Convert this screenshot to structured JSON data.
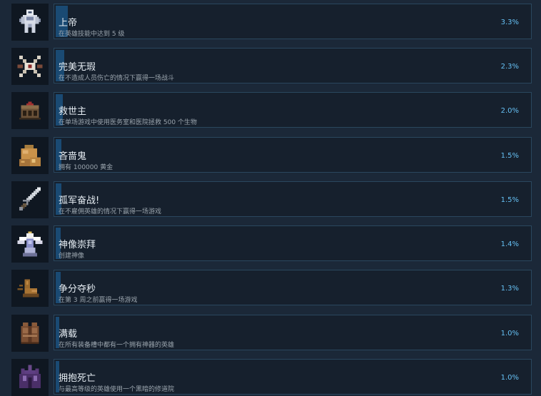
{
  "achievements": [
    {
      "title": "上帝",
      "description": "在英雄技能中达到 5 级",
      "percent_label": "3.3%",
      "percent_value": 3.3,
      "icon": "armored-god-icon"
    },
    {
      "title": "完美无瑕",
      "description": "在不造成人员伤亡的情况下赢得一场战斗",
      "percent_label": "2.3%",
      "percent_value": 2.3,
      "icon": "crossed-bones-eye-icon"
    },
    {
      "title": "救世主",
      "description": "在单场游戏中使用医务室和医院拯救 500 个生物",
      "percent_label": "2.0%",
      "percent_value": 2.0,
      "icon": "hospital-chest-icon"
    },
    {
      "title": "吝啬鬼",
      "description": "拥有 100000 黄金",
      "percent_label": "1.5%",
      "percent_value": 1.5,
      "icon": "gold-sacks-icon"
    },
    {
      "title": "孤军奋战!",
      "description": "在不雇佣英雄的情况下赢得一场游戏",
      "percent_label": "1.5%",
      "percent_value": 1.5,
      "icon": "sword-icon"
    },
    {
      "title": "神像崇拜",
      "description": "创建神像",
      "percent_label": "1.4%",
      "percent_value": 1.4,
      "icon": "winged-statue-icon"
    },
    {
      "title": "争分夺秒",
      "description": "在第 3 周之前赢得一场游戏",
      "percent_label": "1.3%",
      "percent_value": 1.3,
      "icon": "running-boot-icon"
    },
    {
      "title": "满载",
      "description": "在所有装备槽中都有一个拥有神器的英雄",
      "percent_label": "1.0%",
      "percent_value": 1.0,
      "icon": "armor-vest-icon"
    },
    {
      "title": "拥抱死亡",
      "description": "与最高等级的英雄使用一个黑暗的修道院",
      "percent_label": "1.0%",
      "percent_value": 1.0,
      "icon": "dark-cathedral-icon"
    }
  ]
}
